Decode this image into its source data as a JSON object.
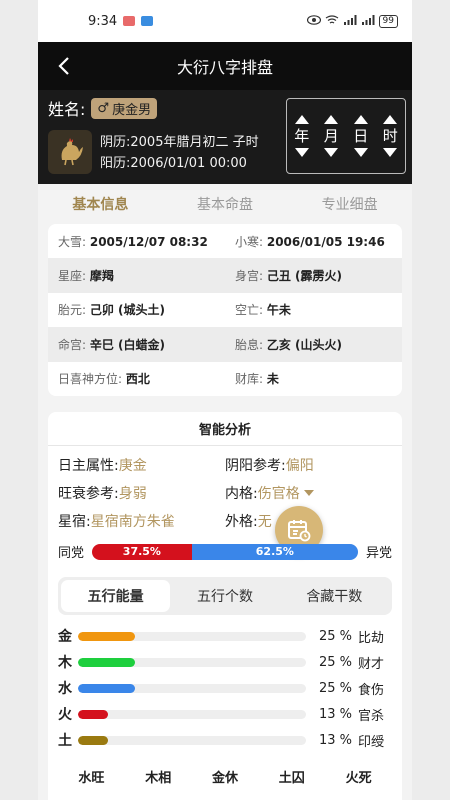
{
  "status": {
    "time": "9:34",
    "battery": "99"
  },
  "topbar": {
    "title": "大衍八字排盘"
  },
  "profile": {
    "name_label": "姓名:",
    "gender_symbol": "♂",
    "name": "庚金男",
    "lunar": "阴历:2005年腊月初二 子时",
    "solar": "阳历:2006/01/01 00:00"
  },
  "adjust": {
    "items": [
      "年",
      "月",
      "日",
      "时"
    ]
  },
  "tabs": [
    "基本信息",
    "基本命盘",
    "专业细盘"
  ],
  "info": {
    "rows": [
      [
        {
          "k": "大雪: ",
          "v": "2005/12/07 08:32"
        },
        {
          "k": "小寒: ",
          "v": "2006/01/05 19:46"
        }
      ],
      [
        {
          "k": "星座: ",
          "v": "摩羯"
        },
        {
          "k": "身宫: ",
          "v": "己丑 (霹雳火)"
        }
      ],
      [
        {
          "k": "胎元: ",
          "v": "己卯 (城头土)"
        },
        {
          "k": "空亡: ",
          "v": "午未"
        }
      ],
      [
        {
          "k": "命宫: ",
          "v": "辛巳 (白蜡金)"
        },
        {
          "k": "胎息: ",
          "v": "乙亥 (山头火)"
        }
      ],
      [
        {
          "k": "日喜神方位: ",
          "v": "西北"
        },
        {
          "k": "财库: ",
          "v": "未"
        }
      ]
    ]
  },
  "analysis": {
    "title": "智能分析",
    "attrs": [
      {
        "k": "日主属性: ",
        "v": "庚金"
      },
      {
        "k": "阴阳参考: ",
        "v": "偏阳"
      },
      {
        "k": "旺衰参考:",
        "v": "身弱"
      },
      {
        "k": "内格:",
        "v": "伤官格"
      },
      {
        "k": "星宿:",
        "v": "星宿南方朱雀"
      },
      {
        "k": "外格:",
        "v": "无"
      }
    ],
    "party": {
      "left_label": "同党",
      "right_label": "异党",
      "left_pct": 37.5,
      "left_text": "37.5%",
      "right_text": "62.5%"
    },
    "seg_tabs": [
      "五行能量",
      "五行个数",
      "含藏干数"
    ],
    "elements": [
      {
        "name": "金",
        "pct": 25,
        "pct_text": "25 %",
        "rel": "比劫",
        "color": "#f0960f"
      },
      {
        "name": "木",
        "pct": 25,
        "pct_text": "25 %",
        "rel": "财才",
        "color": "#1ecf3e"
      },
      {
        "name": "水",
        "pct": 25,
        "pct_text": "25 %",
        "rel": "食伤",
        "color": "#3a86e9"
      },
      {
        "name": "火",
        "pct": 13,
        "pct_text": "13 %",
        "rel": "官杀",
        "color": "#d4111d"
      },
      {
        "name": "土",
        "pct": 13,
        "pct_text": "13 %",
        "rel": "印绶",
        "color": "#9a7a10"
      }
    ],
    "seasons": [
      "水旺",
      "木相",
      "金休",
      "土囚",
      "火死"
    ]
  }
}
